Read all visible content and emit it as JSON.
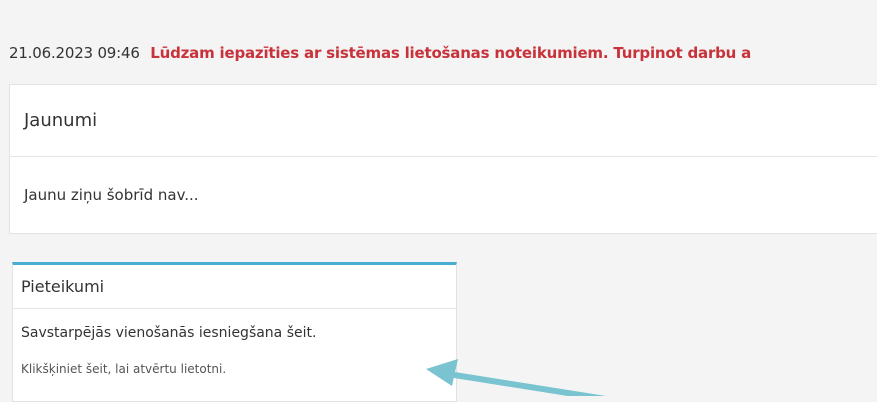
{
  "notice": {
    "datetime": "21.06.2023 09:46",
    "message": "Lūdzam iepazīties ar sistēmas lietošanas noteikumiem. Turpinot darbu a"
  },
  "news": {
    "title": "Jaunumi",
    "empty_text": "Jaunu ziņu šobrīd nav..."
  },
  "app_card": {
    "title": "Pieteikumi",
    "description": "Savstarpējās vienošanās iesniegšana šeit.",
    "link_text": "Klikšķiniet šeit, lai atvērtu lietotni."
  },
  "colors": {
    "warning_text": "#c8323a",
    "card_accent": "#4aaccf",
    "annotation_arrow": "#7ac3d0"
  },
  "annotation": {
    "icon": "arrow-pointer-icon"
  }
}
